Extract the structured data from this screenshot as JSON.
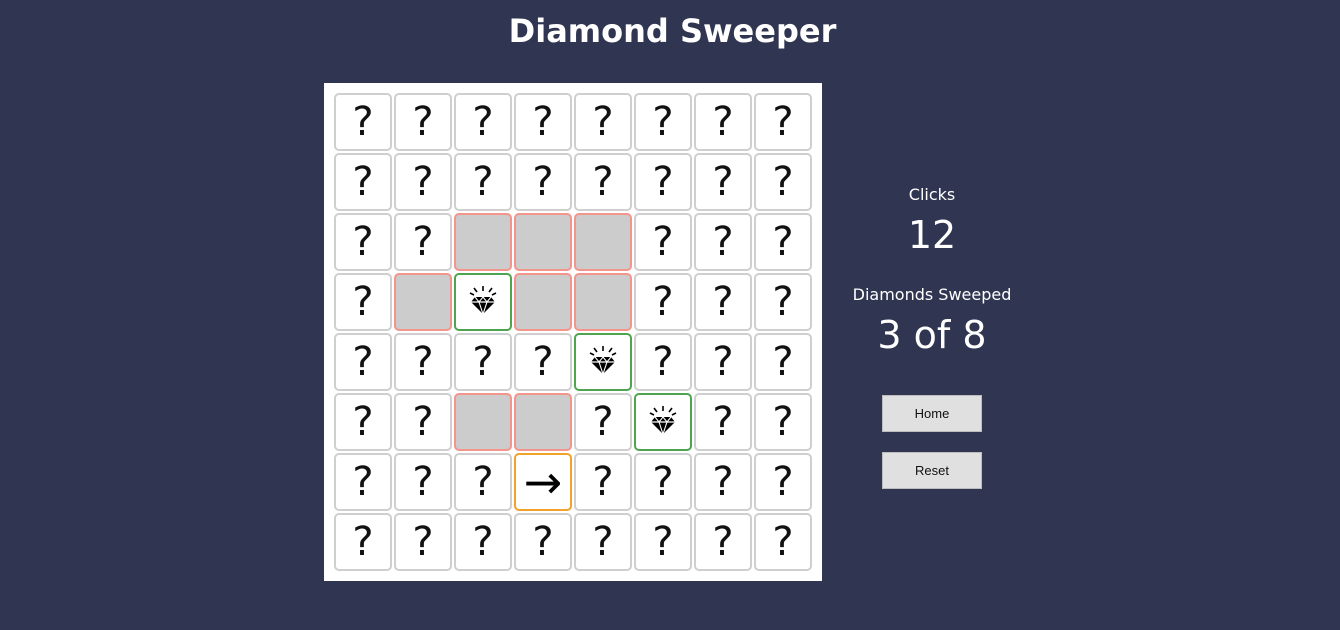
{
  "title": "Diamond Sweeper",
  "stats": {
    "clicks_label": "Clicks",
    "clicks_value": "12",
    "sweeped_label": "Diamonds Sweeped",
    "sweeped_value": "3 of 8"
  },
  "buttons": {
    "home": "Home",
    "reset": "Reset"
  },
  "board": {
    "rows": 8,
    "cols": 8,
    "hidden_symbol": "?",
    "arrow_symbol": "→",
    "cells": [
      [
        "hidden",
        "hidden",
        "hidden",
        "hidden",
        "hidden",
        "hidden",
        "hidden",
        "hidden"
      ],
      [
        "hidden",
        "hidden",
        "hidden",
        "hidden",
        "hidden",
        "hidden",
        "hidden",
        "hidden"
      ],
      [
        "hidden",
        "hidden",
        "empty",
        "empty",
        "empty",
        "hidden",
        "hidden",
        "hidden"
      ],
      [
        "hidden",
        "empty",
        "diamond",
        "empty",
        "empty",
        "hidden",
        "hidden",
        "hidden"
      ],
      [
        "hidden",
        "hidden",
        "hidden",
        "hidden",
        "diamond",
        "hidden",
        "hidden",
        "hidden"
      ],
      [
        "hidden",
        "hidden",
        "empty",
        "empty",
        "hidden",
        "diamond",
        "hidden",
        "hidden"
      ],
      [
        "hidden",
        "hidden",
        "hidden",
        "arrow",
        "hidden",
        "hidden",
        "hidden",
        "hidden"
      ],
      [
        "hidden",
        "hidden",
        "hidden",
        "hidden",
        "hidden",
        "hidden",
        "hidden",
        "hidden"
      ]
    ]
  },
  "colors": {
    "background": "#303652",
    "revealed_empty_fill": "#cccccc",
    "revealed_empty_border": "#f3958c",
    "diamond_border": "#4fa54f",
    "arrow_border": "#f0a22c"
  }
}
